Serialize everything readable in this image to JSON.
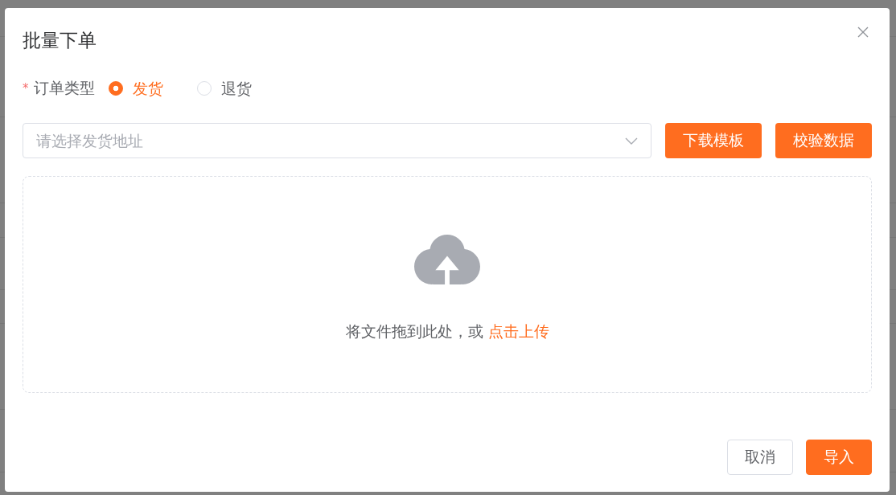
{
  "dialog": {
    "title": "批量下单"
  },
  "order_type": {
    "required_mark": "*",
    "label": "订单类型",
    "options": [
      {
        "label": "发货",
        "selected": true
      },
      {
        "label": "退货",
        "selected": false
      }
    ]
  },
  "address_select": {
    "placeholder": "请选择发货地址"
  },
  "action_buttons": [
    "下载模板",
    "校验数据"
  ],
  "upload": {
    "hint": "将文件拖到此处，或",
    "link": "点击上传"
  },
  "footer_buttons": [
    {
      "label": "取消",
      "kind": "secondary"
    },
    {
      "label": "导入",
      "kind": "primary"
    }
  ]
}
